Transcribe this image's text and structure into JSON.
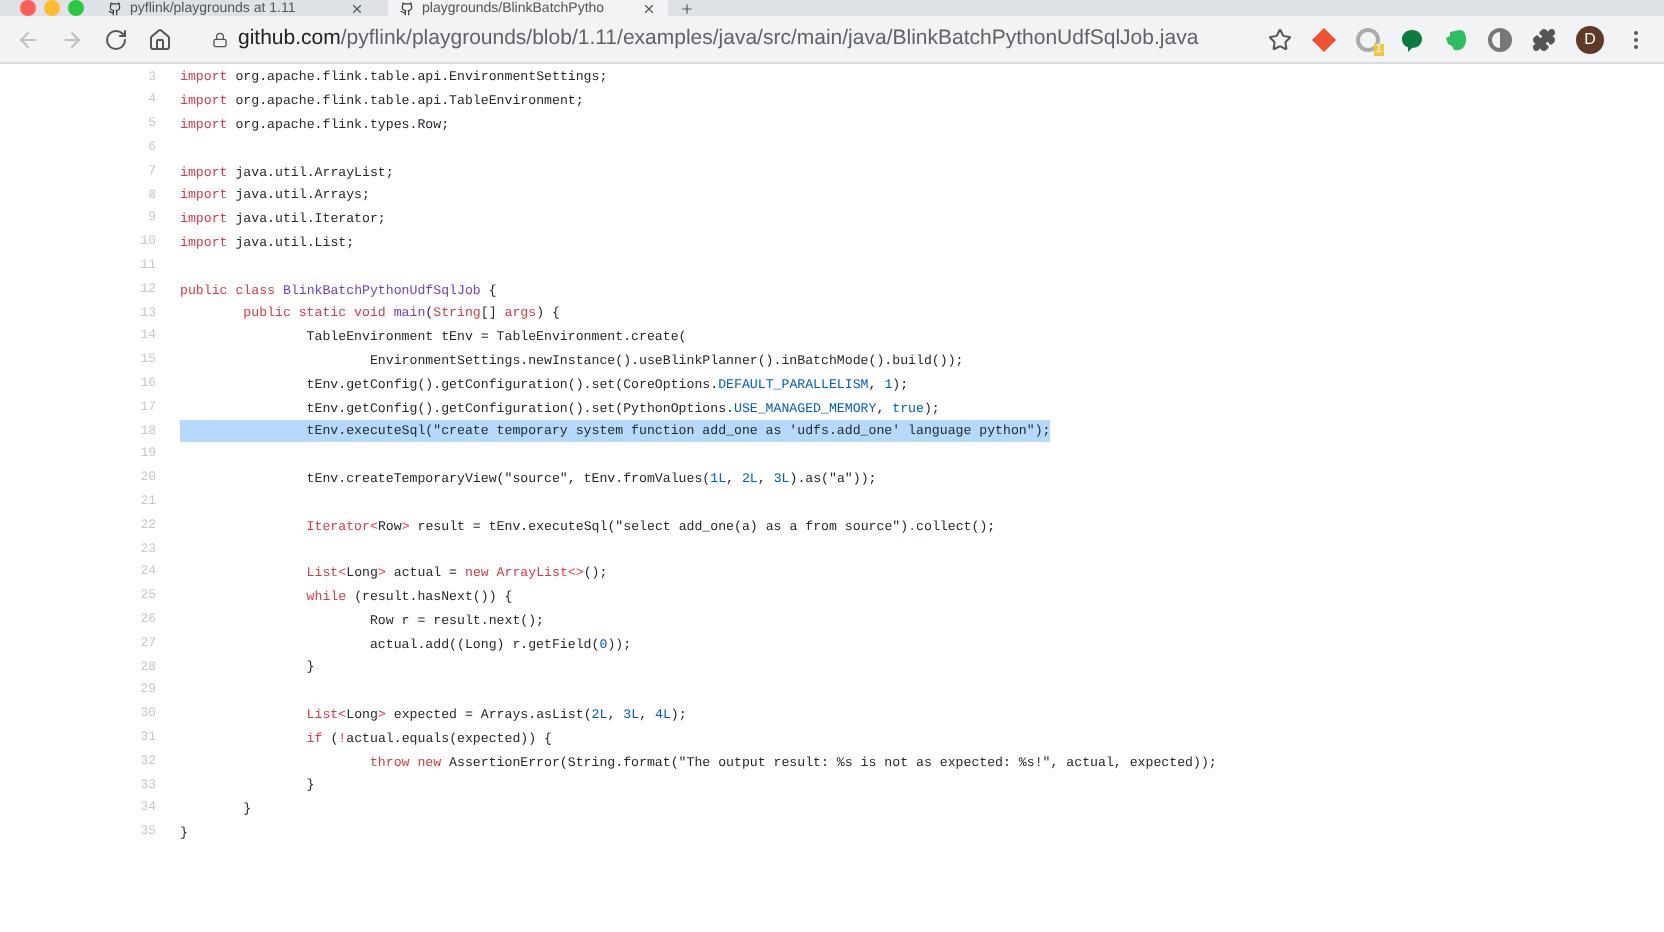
{
  "tabs": [
    {
      "title": "pyflink/playgrounds at 1.11",
      "selected": false
    },
    {
      "title": "playgrounds/BlinkBatchPytho",
      "selected": true
    }
  ],
  "address_bar": {
    "domain": "github.com",
    "path": "/pyflink/playgrounds/blob/1.11/examples/java/src/main/java/BlinkBatchPythonUdfSqlJob.java"
  },
  "extension_badge": "1",
  "profile_initial": "D",
  "lines": [
    {
      "number": "3",
      "selected": false,
      "segments": [
        {
          "kind": "keyword",
          "text": "import"
        },
        {
          "kind": "plain",
          "text": " org.apache.flink.table.api.EnvironmentSettings;"
        }
      ]
    },
    {
      "number": "4",
      "selected": false,
      "segments": [
        {
          "kind": "keyword",
          "text": "import"
        },
        {
          "kind": "plain",
          "text": " org.apache.flink.table.api.TableEnvironment;"
        }
      ]
    },
    {
      "number": "5",
      "selected": false,
      "segments": [
        {
          "kind": "keyword",
          "text": "import"
        },
        {
          "kind": "plain",
          "text": " org.apache.flink.types.Row;"
        }
      ]
    },
    {
      "number": "6"
    },
    {
      "number": "7",
      "selected": false,
      "segments": [
        {
          "kind": "keyword",
          "text": "import"
        },
        {
          "kind": "plain",
          "text": " java.util.ArrayList;"
        }
      ]
    },
    {
      "number": "8",
      "selected": false,
      "segments": [
        {
          "kind": "keyword",
          "text": "import"
        },
        {
          "kind": "plain",
          "text": " java.util.Arrays;"
        }
      ]
    },
    {
      "number": "9",
      "selected": false,
      "segments": [
        {
          "kind": "keyword",
          "text": "import"
        },
        {
          "kind": "plain",
          "text": " java.util.Iterator;"
        }
      ]
    },
    {
      "number": "10",
      "selected": false,
      "segments": [
        {
          "kind": "keyword",
          "text": "import"
        },
        {
          "kind": "plain",
          "text": " java.util.List;"
        }
      ]
    },
    {
      "number": "11"
    },
    {
      "number": "12",
      "selected": false,
      "segments": [
        {
          "kind": "keyword",
          "text": "public class "
        },
        {
          "kind": "entity",
          "text": "BlinkBatchPythonUdfSqlJob"
        },
        {
          "kind": "plain",
          "text": " {"
        }
      ]
    },
    {
      "number": "13",
      "selected": false,
      "segments": [
        {
          "kind": "keyword",
          "text": "        public static void "
        },
        {
          "kind": "entity",
          "text": "main"
        },
        {
          "kind": "plain",
          "text": "("
        },
        {
          "kind": "keyword",
          "text": "String"
        },
        {
          "kind": "plain",
          "text": "[] "
        },
        {
          "kind": "keyword",
          "text": "args"
        },
        {
          "kind": "plain",
          "text": ") {"
        }
      ]
    },
    {
      "number": "14",
      "selected": false,
      "segments": [
        {
          "kind": "plain",
          "text": "                TableEnvironment tEnv = TableEnvironment.create("
        }
      ]
    },
    {
      "number": "15",
      "selected": false,
      "segments": [
        {
          "kind": "plain",
          "text": "                        EnvironmentSettings.newInstance().useBlinkPlanner().inBatchMode().build());"
        }
      ]
    },
    {
      "number": "16",
      "selected": false,
      "segments": [
        {
          "kind": "plain",
          "text": "                tEnv.getConfig().getConfiguration().set(CoreOptions."
        },
        {
          "kind": "constant",
          "text": "DEFAULT_PARALLELISM"
        },
        {
          "kind": "plain",
          "text": ", "
        },
        {
          "kind": "constant",
          "text": "1"
        },
        {
          "kind": "plain",
          "text": ");"
        }
      ]
    },
    {
      "number": "17",
      "selected": false,
      "segments": [
        {
          "kind": "plain",
          "text": "                tEnv.getConfig().getConfiguration().set(PythonOptions."
        },
        {
          "kind": "constant",
          "text": "USE_MANAGED_MEMORY"
        },
        {
          "kind": "plain",
          "text": ", "
        },
        {
          "kind": "constant",
          "text": "true"
        },
        {
          "kind": "plain",
          "text": ");"
        }
      ]
    },
    {
      "number": "18",
      "selected": true,
      "segments": [
        {
          "kind": "plain",
          "text": "                tEnv.executeSql(\"create temporary system function add_one as 'udfs.add_one' language python\");"
        }
      ]
    },
    {
      "number": "19"
    },
    {
      "number": "20",
      "selected": false,
      "segments": [
        {
          "kind": "plain",
          "text": "                tEnv.createTemporaryView(\"source\", tEnv.fromValues("
        },
        {
          "kind": "constant",
          "text": "1L"
        },
        {
          "kind": "plain",
          "text": ", "
        },
        {
          "kind": "constant",
          "text": "2L"
        },
        {
          "kind": "plain",
          "text": ", "
        },
        {
          "kind": "constant",
          "text": "3L"
        },
        {
          "kind": "plain",
          "text": ").as(\"a\"));"
        }
      ]
    },
    {
      "number": "21"
    },
    {
      "number": "22",
      "selected": false,
      "segments": [
        {
          "kind": "keyword",
          "text": "                Iterator<"
        },
        {
          "kind": "plain",
          "text": "Row"
        },
        {
          "kind": "keyword",
          "text": ">"
        },
        {
          "kind": "plain",
          "text": " result = tEnv.executeSql(\"select add_one(a) as a from source\")"
        },
        {
          "kind": "keyword",
          "text": "."
        },
        {
          "kind": "plain",
          "text": "collect();"
        }
      ]
    },
    {
      "number": "23"
    },
    {
      "number": "24",
      "selected": false,
      "segments": [
        {
          "kind": "keyword",
          "text": "                List<"
        },
        {
          "kind": "plain",
          "text": "Long"
        },
        {
          "kind": "keyword",
          "text": ">"
        },
        {
          "kind": "plain",
          "text": " actual = "
        },
        {
          "kind": "keyword",
          "text": "new ArrayList<>"
        },
        {
          "kind": "plain",
          "text": "();"
        }
      ]
    },
    {
      "number": "25",
      "selected": false,
      "segments": [
        {
          "kind": "keyword",
          "text": "                while"
        },
        {
          "kind": "plain",
          "text": " (result.hasNext()) {"
        }
      ]
    },
    {
      "number": "26",
      "selected": false,
      "segments": [
        {
          "kind": "plain",
          "text": "                        Row r = result.next();"
        }
      ]
    },
    {
      "number": "27",
      "selected": false,
      "segments": [
        {
          "kind": "plain",
          "text": "                        actual.add((Long) r.getField("
        },
        {
          "kind": "constant",
          "text": "0"
        },
        {
          "kind": "plain",
          "text": "));"
        }
      ]
    },
    {
      "number": "28",
      "selected": false,
      "segments": [
        {
          "kind": "plain",
          "text": "                }"
        }
      ]
    },
    {
      "number": "29"
    },
    {
      "number": "30",
      "selected": false,
      "segments": [
        {
          "kind": "keyword",
          "text": "                List<"
        },
        {
          "kind": "plain",
          "text": "Long"
        },
        {
          "kind": "keyword",
          "text": ">"
        },
        {
          "kind": "plain",
          "text": " expected = Arrays.asList("
        },
        {
          "kind": "constant",
          "text": "2L"
        },
        {
          "kind": "plain",
          "text": ", "
        },
        {
          "kind": "constant",
          "text": "3L"
        },
        {
          "kind": "plain",
          "text": ", "
        },
        {
          "kind": "constant",
          "text": "4L"
        },
        {
          "kind": "plain",
          "text": ");"
        }
      ]
    },
    {
      "number": "31",
      "selected": false,
      "segments": [
        {
          "kind": "keyword",
          "text": "                if"
        },
        {
          "kind": "plain",
          "text": " ("
        },
        {
          "kind": "keyword",
          "text": "!"
        },
        {
          "kind": "plain",
          "text": "actual.equals(expected)) {"
        }
      ]
    },
    {
      "number": "32",
      "selected": false,
      "segments": [
        {
          "kind": "keyword",
          "text": "                        throw new"
        },
        {
          "kind": "plain",
          "text": " AssertionError(String.format(\"The output result: %s is not as expected: %s!\", actual, expected));"
        }
      ]
    },
    {
      "number": "33",
      "selected": false,
      "segments": [
        {
          "kind": "plain",
          "text": "                }"
        }
      ]
    },
    {
      "number": "34",
      "selected": false,
      "segments": [
        {
          "kind": "plain",
          "text": "        }"
        }
      ]
    },
    {
      "number": "35",
      "selected": false,
      "segments": [
        {
          "kind": "plain",
          "text": "}"
        }
      ]
    }
  ]
}
